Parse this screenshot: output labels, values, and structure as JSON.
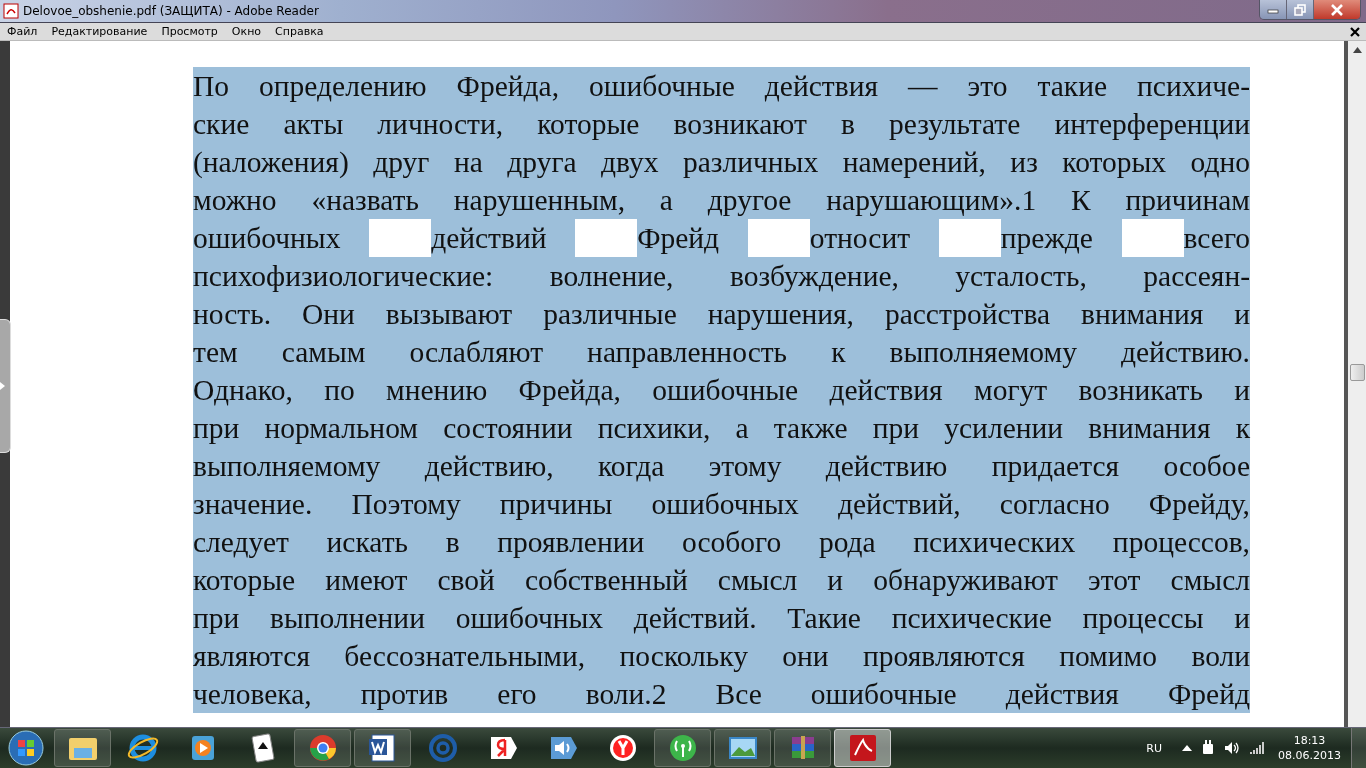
{
  "window": {
    "title": "Delovoe_obshenie.pdf (ЗАЩИТА) - Adobe Reader"
  },
  "menu": [
    "Файл",
    "Редактирование",
    "Просмотр",
    "Окно",
    "Справка"
  ],
  "document": {
    "selected": true,
    "lines": [
      {
        "kind": "plain",
        "text": "По определению Фрейда, ошибочные действия — это такие психиче-"
      },
      {
        "kind": "plain",
        "text": "ские акты личности, которые возникают в результате интерференции"
      },
      {
        "kind": "plain",
        "text": "(наложения) друг на друга двух различных намерений, из которых одно"
      },
      {
        "kind": "plain",
        "text": "можно «назвать нарушенным, а другое нарушающим».1 К причинам"
      },
      {
        "kind": "gapped",
        "text": "ошибочных действий Фрейд относит прежде всего"
      },
      {
        "kind": "plain",
        "text": "психофизиологические: волнение, возбуждение, усталость, рассеян-"
      },
      {
        "kind": "plain",
        "text": "ность. Они вызывают различные нарушения, расстройства внимания и"
      },
      {
        "kind": "plain",
        "text": "тем самым ослабляют направленность к выполняемому действию."
      },
      {
        "kind": "plain",
        "text": "Однако, по мнению Фрейда, ошибочные действия могут возникать и"
      },
      {
        "kind": "plain",
        "text": "при нормальном состоянии психики, а также при усилении внимания к"
      },
      {
        "kind": "plain",
        "text": "выполняемому действию, когда этому действию придается особое"
      },
      {
        "kind": "plain",
        "text": "значение. Поэтому причины ошибочных действий, согласно Фрейду,"
      },
      {
        "kind": "plain",
        "text": "следует искать в проявлении особого рода психических процессов,"
      },
      {
        "kind": "plain",
        "text": "которые имеют свой собственный смысл и обнаруживают этот смысл"
      },
      {
        "kind": "plain",
        "text": "при выполнении ошибочных действий. Такие психические процессы и"
      },
      {
        "kind": "plain",
        "text": "являются бессознательными, поскольку они проявляются помимо воли"
      },
      {
        "kind": "plain",
        "text": "человека, против его воли.2 Все ошибочные действия Фрейд"
      }
    ]
  },
  "taskbar": {
    "items": [
      {
        "kind": "explorer",
        "running": true,
        "active": false
      },
      {
        "kind": "ie",
        "running": false,
        "active": false
      },
      {
        "kind": "media",
        "running": false,
        "active": false
      },
      {
        "kind": "cards",
        "running": false,
        "active": false
      },
      {
        "kind": "chrome",
        "running": true,
        "active": false
      },
      {
        "kind": "word",
        "running": true,
        "active": false
      },
      {
        "kind": "mail",
        "running": false,
        "active": false
      },
      {
        "kind": "yandex",
        "running": false,
        "active": false
      },
      {
        "kind": "speaker",
        "running": false,
        "active": false
      },
      {
        "kind": "ybrowser",
        "running": false,
        "active": false
      },
      {
        "kind": "antenna",
        "running": true,
        "active": false
      },
      {
        "kind": "photo",
        "running": true,
        "active": false
      },
      {
        "kind": "archive",
        "running": true,
        "active": false
      },
      {
        "kind": "pdf",
        "running": true,
        "active": true
      }
    ],
    "tray": {
      "language": "RU",
      "time": "18:13",
      "date": "08.06.2013"
    }
  }
}
